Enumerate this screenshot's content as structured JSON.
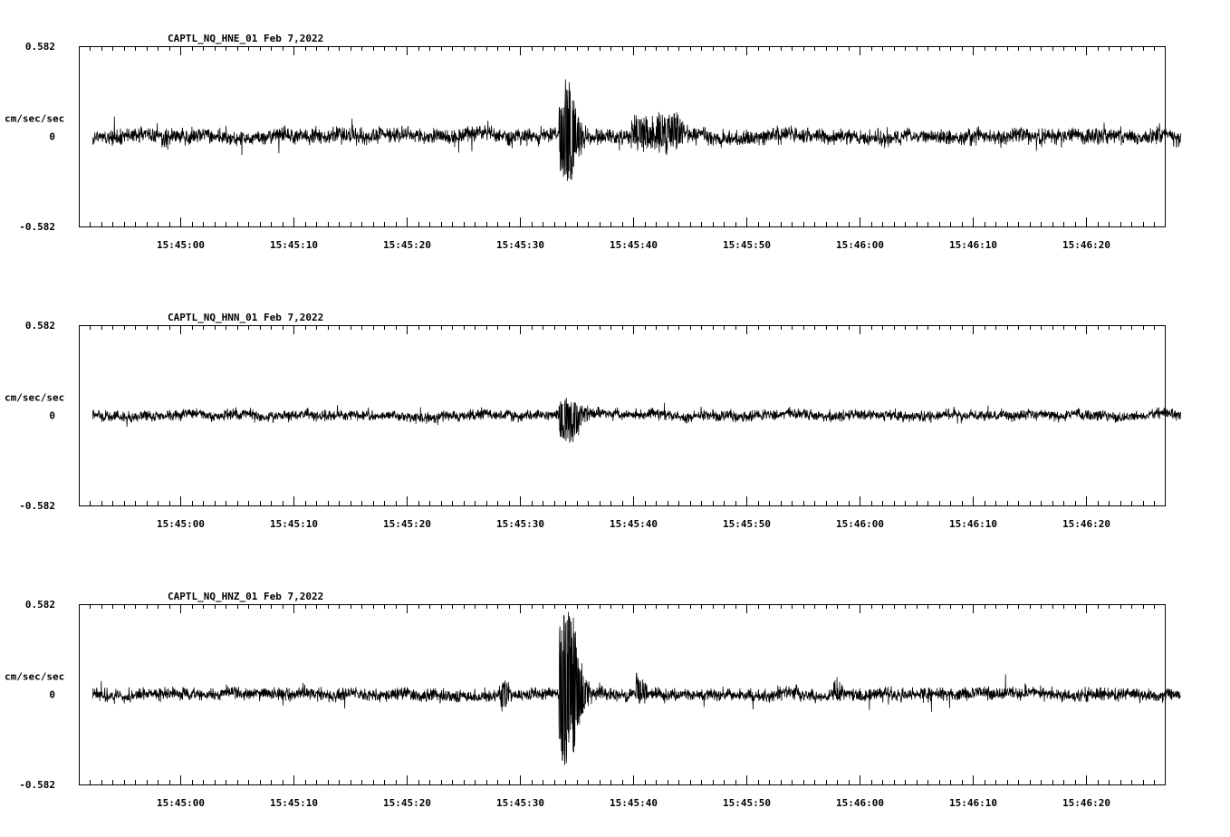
{
  "chart_data": [
    {
      "type": "line",
      "title": "CAPTL_NQ_HNE_01  Feb 7,2022",
      "ylabel": "cm/sec/sec",
      "ylim": [
        -0.582,
        0.582
      ],
      "yticks": [
        "0.582",
        "0",
        "-0.582"
      ],
      "xticks": [
        "15:45:00",
        "15:45:10",
        "15:45:20",
        "15:45:30",
        "15:45:40",
        "15:45:50",
        "15:46:00",
        "15:46:10",
        "15:46:20"
      ],
      "time_range_s": [
        -8.9,
        84.2
      ],
      "trace_range_s": [
        -7.7,
        85.6
      ],
      "noise_amplitude": 0.045,
      "series": [
        {
          "events": [
            {
              "t": 32.3,
              "peak": 0.37,
              "trough": -0.27,
              "duration_s": 1.0
            },
            {
              "t": 38.5,
              "peak": 0.12,
              "trough": -0.07,
              "duration_s": 4.0
            }
          ]
        }
      ]
    },
    {
      "type": "line",
      "title": "CAPTL_NQ_HNN_01  Feb 7,2022",
      "ylabel": "cm/sec/sec",
      "ylim": [
        -0.582,
        0.582
      ],
      "yticks": [
        "0.582",
        "0",
        "-0.582"
      ],
      "xticks": [
        "15:45:00",
        "15:45:10",
        "15:45:20",
        "15:45:30",
        "15:45:40",
        "15:45:50",
        "15:46:00",
        "15:46:10",
        "15:46:20"
      ],
      "time_range_s": [
        -8.9,
        84.2
      ],
      "trace_range_s": [
        -7.7,
        85.6
      ],
      "noise_amplitude": 0.03,
      "series": [
        {
          "events": [
            {
              "t": 32.3,
              "peak": 0.09,
              "trough": -0.16,
              "duration_s": 1.5
            }
          ]
        }
      ]
    },
    {
      "type": "line",
      "title": "CAPTL_NQ_HNZ_01  Feb 7,2022",
      "ylabel": "cm/sec/sec",
      "ylim": [
        -0.582,
        0.582
      ],
      "yticks": [
        "0.582",
        "0",
        "-0.582"
      ],
      "xticks": [
        "15:45:00",
        "15:45:10",
        "15:45:20",
        "15:45:30",
        "15:45:40",
        "15:45:50",
        "15:46:00",
        "15:46:10",
        "15:46:20"
      ],
      "time_range_s": [
        -8.9,
        84.2
      ],
      "trace_range_s": [
        -7.7,
        85.6
      ],
      "noise_amplitude": 0.035,
      "series": [
        {
          "events": [
            {
              "t": 32.3,
              "peak": 0.58,
              "trough": -0.45,
              "duration_s": 1.2
            },
            {
              "t": 38.9,
              "peak": 0.14,
              "trough": -0.05,
              "duration_s": 0.3
            },
            {
              "t": 55.8,
              "peak": 0.11,
              "trough": -0.04,
              "duration_s": 0.3
            },
            {
              "t": 27.3,
              "peak": 0.08,
              "trough": -0.09,
              "duration_s": 0.3
            }
          ]
        }
      ]
    }
  ]
}
